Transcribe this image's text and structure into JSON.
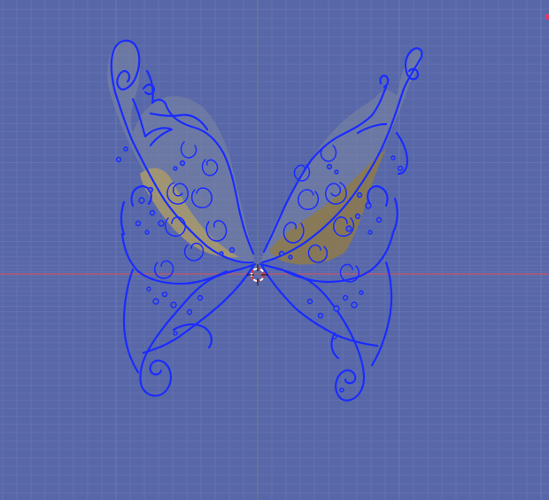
{
  "viewport": {
    "background_color": "#5767a8",
    "grid_color": "#6371b0",
    "grid_major_color": "#6a78b6",
    "x_axis_color": "#c15a6a",
    "y_axis_color": "#6a7c86",
    "edge_color": "#1a2cff",
    "selected_face_color": "#a99a6a"
  },
  "cursor": {
    "icon": "3d-cursor-icon",
    "ring_colors": [
      "#d83c3c",
      "#ffffff"
    ]
  },
  "object": {
    "name_icon": "butterfly-wings-mesh"
  },
  "corner_marker": {
    "icon": "corner-indicator-icon",
    "color": "#e03a6a"
  }
}
